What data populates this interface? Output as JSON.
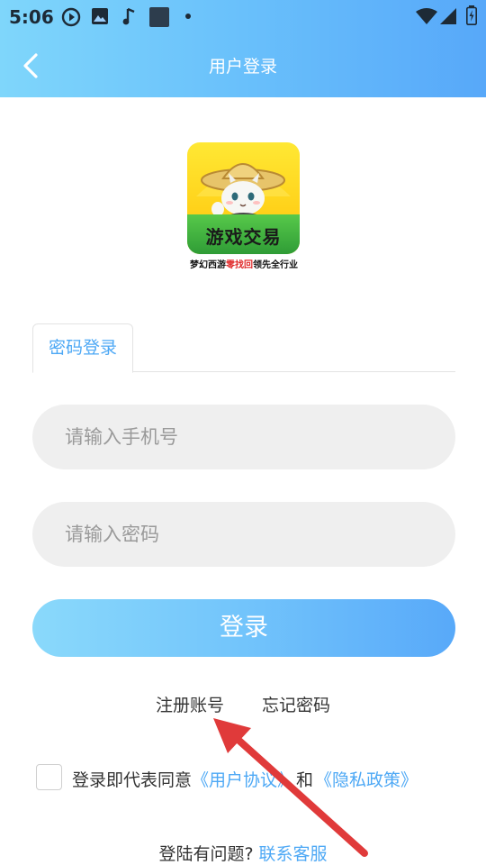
{
  "status_bar": {
    "time": "5:06",
    "left_icons": [
      "play-circle-icon",
      "image-icon",
      "music-note-icon",
      "square-icon",
      "dot-icon"
    ],
    "right_icons": [
      "wifi-icon",
      "signal-icon",
      "battery-icon"
    ]
  },
  "nav": {
    "title": "用户登录",
    "back_icon": "chevron-left-icon"
  },
  "logo": {
    "text": "游戏交易",
    "slogan_part1": "梦幻西游",
    "slogan_highlight": "零找回",
    "slogan_part2": "领先全行业"
  },
  "tabs": [
    {
      "label": "密码登录",
      "active": true
    }
  ],
  "form": {
    "phone_placeholder": "请输入手机号",
    "phone_value": "",
    "password_placeholder": "请输入密码",
    "password_value": "",
    "login_label": "登录"
  },
  "links": {
    "register": "注册账号",
    "forgot": "忘记密码"
  },
  "agreement": {
    "checked": false,
    "prefix": "登录即代表同意",
    "user_agreement": "《用户协议》",
    "and": "和",
    "privacy": "《隐私政策》"
  },
  "help": {
    "question": "登陆有问题?",
    "contact": "联系客服"
  },
  "colors": {
    "accent": "#4da8f5",
    "header_start": "#7fd6fb",
    "header_end": "#57a8f9",
    "annotation_arrow": "#e03a3a"
  }
}
